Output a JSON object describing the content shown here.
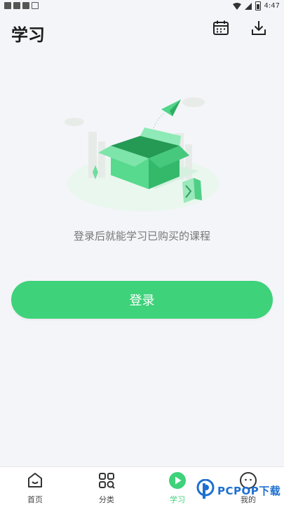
{
  "status_bar": {
    "time": "4:47",
    "icons": [
      "notification-icon",
      "notification-icon",
      "notification-icon",
      "sim-icon",
      "wifi-icon",
      "signal-icon",
      "battery-icon"
    ]
  },
  "header": {
    "title": "学习",
    "icons": [
      "calendar-icon",
      "download-icon"
    ]
  },
  "empty_state": {
    "illustration": "open-box-illustration",
    "message": "登录后就能学习已购买的课程"
  },
  "login_button": {
    "label": "登录"
  },
  "tab_bar": {
    "tabs": [
      {
        "label": "首页",
        "icon": "home-icon",
        "active": false
      },
      {
        "label": "分类",
        "icon": "category-icon",
        "active": false
      },
      {
        "label": "学习",
        "icon": "play-icon",
        "active": true
      },
      {
        "label": "我的",
        "icon": "profile-face-icon",
        "active": false
      }
    ]
  },
  "watermark": {
    "text": "PCPOP下载"
  },
  "colors": {
    "accent": "#3ed27a",
    "background": "#f4f5f9",
    "watermark": "#1e6fd0"
  }
}
